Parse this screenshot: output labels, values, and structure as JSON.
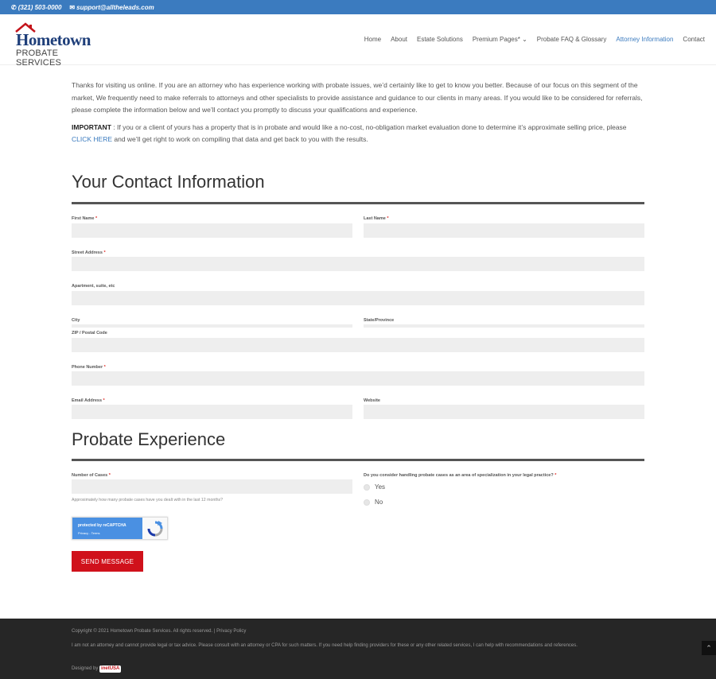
{
  "topbar": {
    "phone": "(321) 503-0000",
    "email": "support@alltheleads.com",
    "phone_icon": "phone-icon",
    "email_icon": "envelope-icon"
  },
  "header": {
    "logo_line1": "Hometown",
    "logo_line2": "PROBATE SERVICES",
    "nav": [
      "Home",
      "About",
      "Estate Solutions",
      "Premium Pages*",
      "Probate FAQ & Glossary",
      "Attorney Information",
      "Contact"
    ],
    "nav_dropdown_icon": "chevron-down-icon",
    "active_color": "#3b7bbf"
  },
  "intro": {
    "p1": "Thanks for visiting us online.  If you are an attorney who has experience working with probate issues, we’d certainly like to get to know you better. Because of our focus on this segment of the market, We frequently need to make referrals to attorneys and other specialists to provide assistance and guidance to our clients in many areas.  If you would like to be considered for referrals, please complete the information below and we’ll contact you promptly to discuss your qualifications and experience.",
    "important_label": "IMPORTANT",
    "p2_before": " : If you or a client of yours has a property that is in probate and would like a no-cost, no-obligation market evaluation done to determine it’s approximate selling price, please ",
    "p2_link": "CLICK HERE",
    "p2_after": " and we’ll get right to work on compiling that data and get back to you with the results."
  },
  "contact": {
    "title": "Your Contact Information",
    "first_name": "First Name",
    "last_name": "Last Name",
    "street": "Street Address",
    "apartment": "Apartment, suite, etc",
    "city": "City",
    "state": "State/Province",
    "zip": "ZIP / Postal Code",
    "phone": "Phone Number",
    "email": "Email Address",
    "website": "Website",
    "required_mark": "*"
  },
  "experience": {
    "title": "Probate Experience",
    "cases_label": "Number of Cases",
    "cases_hint": "Approximately how many probate cases have you dealt with in the last 12 months?",
    "specialization_label": "Do you consider handling probate cases as an area of specialization in your legal practice?",
    "options": [
      "Yes",
      "No"
    ]
  },
  "captcha": {
    "line1": "protected by reCAPTCHA",
    "line2": "Privacy - Terms"
  },
  "send_label": "SEND MESSAGE",
  "footer": {
    "copyright": "Copyright © 2021 Hometown Probate Services. All rights reserved. | Privacy Policy",
    "disclaimer": "I am not an attorney and cannot provide legal or tax advice. Please consult with an attorney or CPA for such matters. If you need help finding providers for these or any other related services, I can help with recommendations and references.",
    "designed_by": "Designed by",
    "designer_badge": "inetUSA",
    "to_top_icon": "chevron-up-icon"
  },
  "colors": {
    "accent": "#3b7bbf",
    "button": "#d0111b",
    "required": "#e02b27",
    "footer_bg": "#262626"
  }
}
